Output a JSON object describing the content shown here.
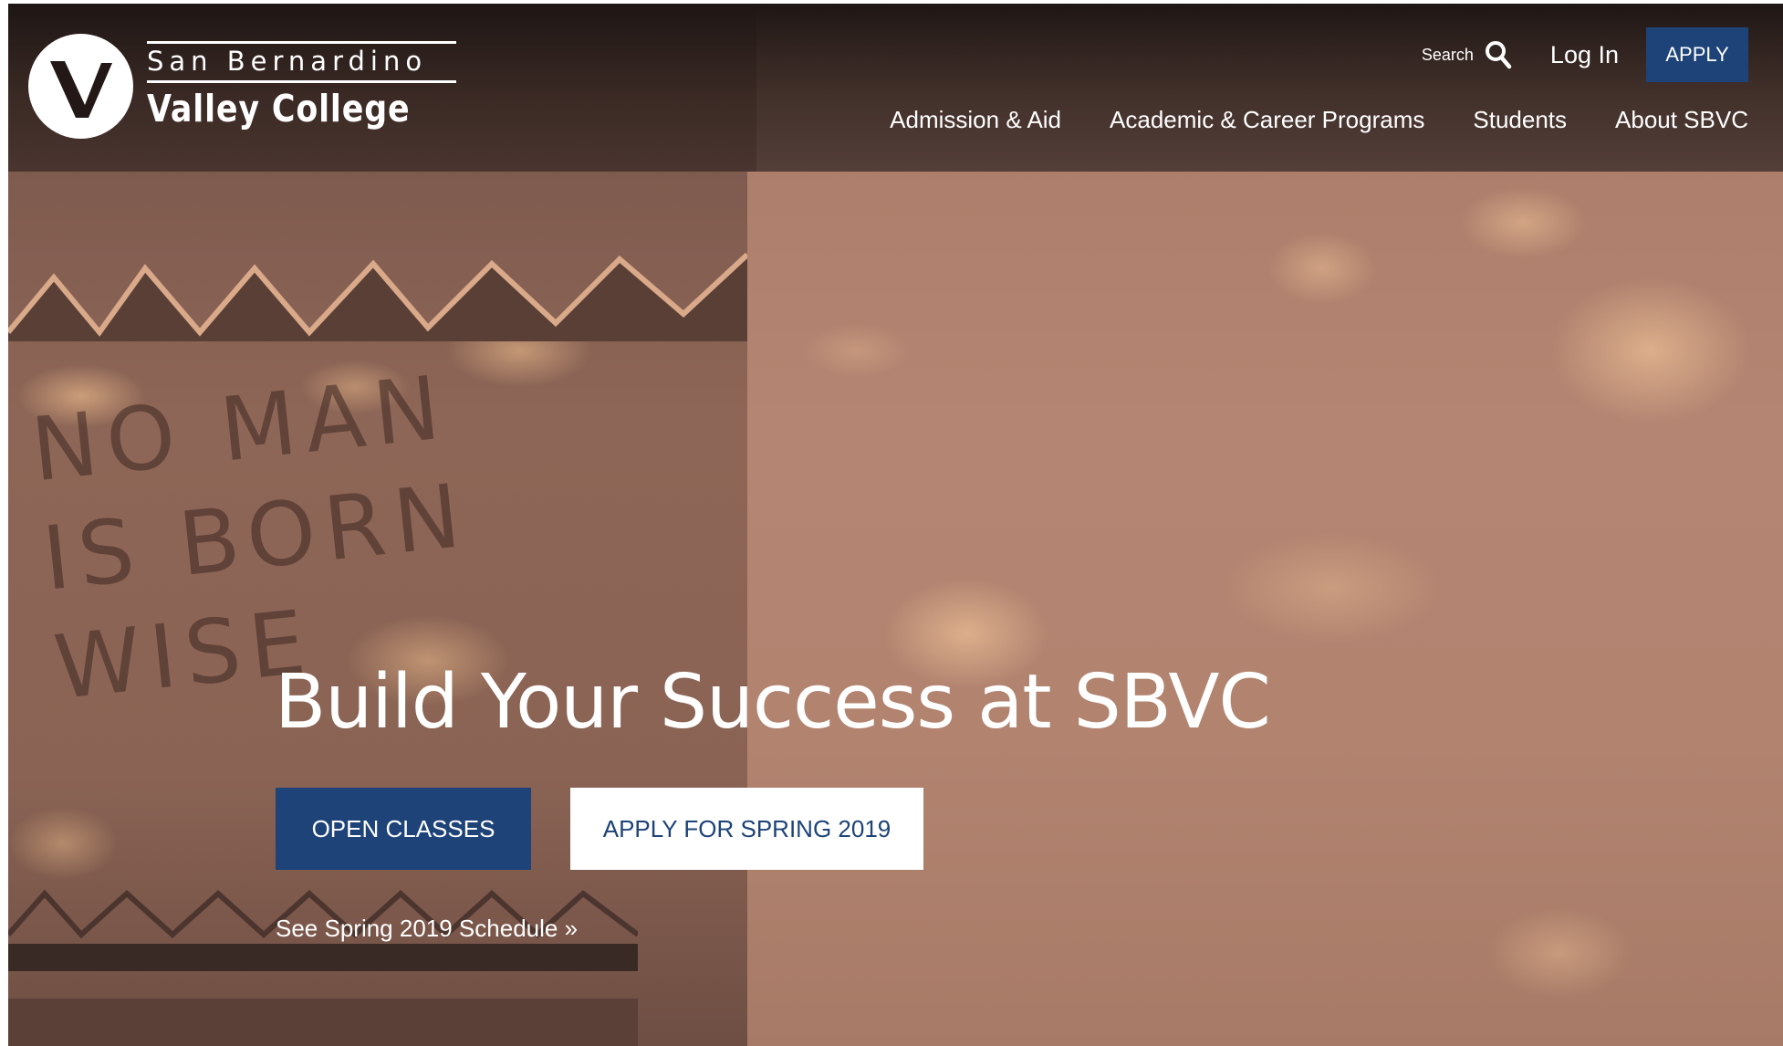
{
  "header": {
    "logo": {
      "line1": "San Bernardino",
      "line2": "Valley College",
      "mark": "V"
    },
    "utility": {
      "search_label": "Search",
      "search_icon": "search-icon",
      "login_label": "Log In",
      "apply_label": "APPLY"
    },
    "nav": [
      {
        "label": "Admission & Aid"
      },
      {
        "label": "Academic & Career Programs"
      },
      {
        "label": "Students"
      },
      {
        "label": "About SBVC"
      }
    ]
  },
  "hero": {
    "title": "Build Your Success at SBVC",
    "primary_button": "OPEN CLASSES",
    "secondary_button": "APPLY FOR SPRING 2019",
    "schedule_link": "See Spring 2019 Schedule »",
    "carved_lines": [
      "NO MAN",
      "IS BORN",
      "WISE"
    ]
  },
  "colors": {
    "brand_blue": "#1d4378",
    "white": "#ffffff",
    "header_band": "#2e211e"
  }
}
